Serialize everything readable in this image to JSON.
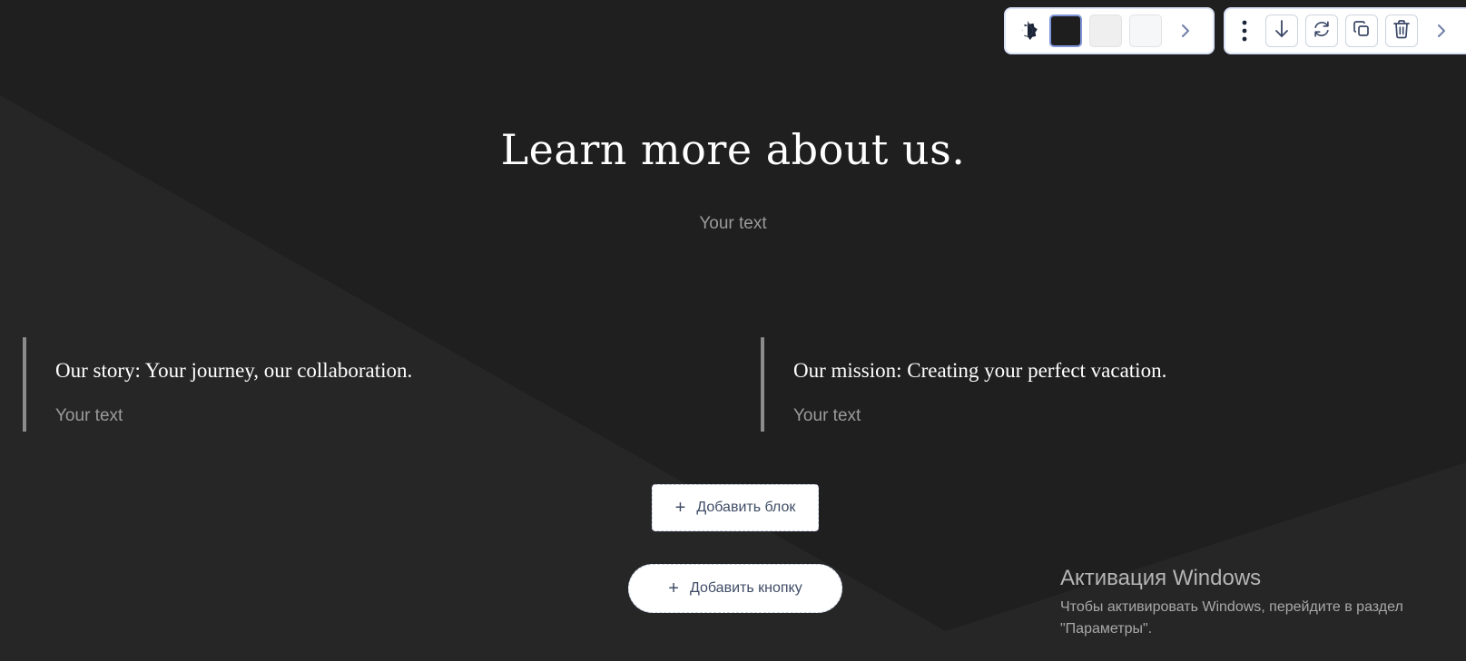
{
  "colors": {
    "background": "#1f1f20",
    "swatch_dark": "#1e1e1f",
    "swatch_light_1": "#efefef",
    "swatch_light_2": "#f6f7f9",
    "accent_border": "#7f95d8"
  },
  "toolbar_left": {
    "icons": [
      "contrast-icon",
      "chevron-right-icon"
    ]
  },
  "toolbar_right": {
    "icons": [
      "more-vertical-icon",
      "arrow-down-icon",
      "refresh-icon",
      "copy-icon",
      "trash-icon",
      "chevron-right-icon"
    ]
  },
  "main": {
    "title": "Learn more about us.",
    "subtitle": "Your text",
    "features": [
      {
        "heading": "Our story: Your journey, our collaboration.",
        "text": "Your text"
      },
      {
        "heading": "Our mission: Creating your perfect vacation.",
        "text": "Your text"
      }
    ],
    "add_block_label": "Добавить блок",
    "add_button_label": "Добавить кнопку"
  },
  "windows_activation": {
    "title": "Активация Windows",
    "line1": "Чтобы активировать Windows, перейдите в раздел",
    "line2": "\"Параметры\"."
  }
}
